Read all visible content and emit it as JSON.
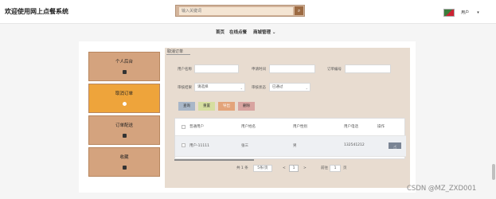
{
  "header": {
    "app_title": "欢迎使用网上点餐系统",
    "search_placeholder": "输入关键词",
    "search_icon_glyph": "⌕",
    "user_label": "用户",
    "user_caret": "▾"
  },
  "nav": {
    "items": [
      {
        "label": "首页"
      },
      {
        "label": "在线点餐"
      },
      {
        "label": "商城管理 ⌄"
      }
    ]
  },
  "sidebar": {
    "items": [
      {
        "label": "个人后台",
        "active": false
      },
      {
        "label": "取消订单",
        "active": true
      },
      {
        "label": "订单配送",
        "active": false
      },
      {
        "label": "收藏",
        "active": false
      }
    ]
  },
  "panel": {
    "title": "取消订单",
    "filters": {
      "username_label": "用户名称",
      "username_value": "",
      "date_label": "申请时间",
      "date_value": "",
      "order_no_label": "订单编号",
      "order_no_value": "",
      "audit_result_label": "审核结果",
      "audit_result_value": "请选择",
      "audit_status_label": "审核状态",
      "audit_status_value": "已通过"
    },
    "buttons": {
      "search": "查询",
      "reset": "重置",
      "export": "导出",
      "delete": "删除"
    },
    "table": {
      "columns": [
        "",
        "普通用户",
        "用户姓名",
        "用户性别",
        "用户电话",
        "操作"
      ],
      "rows": [
        {
          "account": "用户-11111",
          "name": "张三",
          "gender": "男",
          "phone": "132541212"
        }
      ]
    },
    "pagination": {
      "total": "共 1 条",
      "page_size": "5条/页",
      "prev": "<",
      "current_page": "1",
      "next": ">",
      "goto_label": "前往",
      "goto_value": "1",
      "page_unit": "页"
    }
  },
  "watermark": "CSDN @MZ_ZXD001",
  "colors": {
    "sidebar_bg": "#d4a37e",
    "sidebar_active": "#eea43b",
    "main_bg": "#e8dcd0",
    "search_btn": "#9c6a42",
    "btn_search": "#a9b7c8",
    "btn_reset": "#d6dea0",
    "btn_export": "#e3a47a",
    "btn_delete": "#d8a4a0"
  }
}
